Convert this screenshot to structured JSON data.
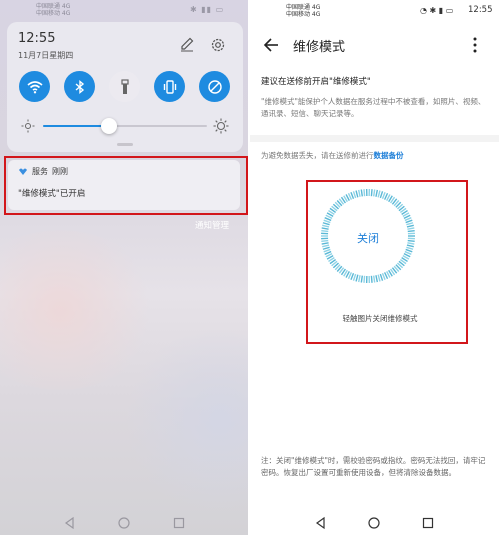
{
  "left": {
    "statusbar": {
      "carrier1": "中国联通 4G",
      "carrier2": "中国移动 4G"
    },
    "quick_settings": {
      "time": "12:55",
      "date": "11月7日星期四",
      "brightness_level": 0.4,
      "tiles": [
        {
          "name": "wifi-icon",
          "active": true
        },
        {
          "name": "bluetooth-icon",
          "active": true
        },
        {
          "name": "flashlight-icon",
          "active": false
        },
        {
          "name": "vibrate-icon",
          "active": true
        },
        {
          "name": "auto-rotate-icon",
          "active": true
        }
      ]
    },
    "notification": {
      "app_name": "服务",
      "time": "刚刚",
      "text": "\"维修模式\"已开启"
    },
    "notification_manage": "通知管理"
  },
  "right": {
    "statusbar": {
      "carrier1": "中国联通 4G",
      "carrier2": "中国移动 4G",
      "time": "12:55"
    },
    "appbar": {
      "title": "维修模式"
    },
    "section_title": "建议在送修前开启\"维修模式\"",
    "description": "\"维修模式\"能保护个人数据在服务过程中不被查看，如照片、视频、通讯录、短信、聊天记录等。",
    "backup_prefix": "为避免数据丢失，请在送修前进行",
    "backup_link": "数据备份",
    "dial_label": "关闭",
    "dial_hint": "轻触图片关闭维修模式",
    "note": "注：关闭\"维修模式\"时，需校验密码或指纹。密码无法找回，请牢记密码。恢复出厂设置可重新使用设备，但将清除设备数据。"
  },
  "colors": {
    "accent": "#1e8be0",
    "link": "#1e7fd8",
    "highlight_box": "#d2161b"
  }
}
